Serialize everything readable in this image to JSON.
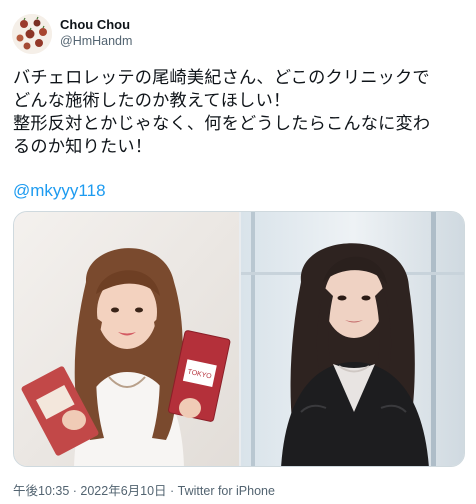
{
  "user": {
    "display_name": "Chou Chou",
    "handle": "@HmHandm",
    "avatar_icon": "avatar-icon"
  },
  "tweet": {
    "lines": [
      "バチェロレッテの尾崎美紀さん、どこのクリニックで",
      "どんな施術したのか教えてほしい！",
      "整形反対とかじゃなく、何をどうしたらこんなに変わ",
      "るのか知りたい！"
    ],
    "mention": "@mkyyy118"
  },
  "media": {
    "photos": [
      {
        "name": "photo-left",
        "accent": "#c94a4a"
      },
      {
        "name": "photo-right",
        "accent": "#2b2b2b"
      }
    ]
  },
  "meta": {
    "time": "午後10:35",
    "separator1": " · ",
    "date": "2022年6月10日",
    "separator2": " · ",
    "source": "Twitter for iPhone"
  },
  "colors": {
    "link": "#1d9bf0",
    "secondary_text": "#536471",
    "primary_text": "#0f1419"
  }
}
